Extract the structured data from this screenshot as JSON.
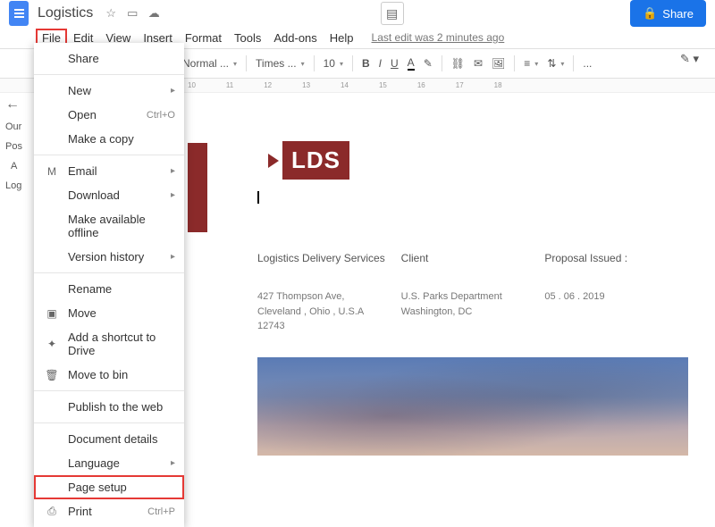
{
  "title": "Logistics",
  "shareLabel": "Share",
  "lastEdit": "Last edit was 2 minutes ago",
  "menus": {
    "file": "File",
    "edit": "Edit",
    "view": "View",
    "insert": "Insert",
    "format": "Format",
    "tools": "Tools",
    "addons": "Add-ons",
    "help": "Help"
  },
  "toolbar": {
    "style": "Normal ...",
    "font": "Times ...",
    "size": "10",
    "more": "..."
  },
  "ruler": [
    "10",
    "11",
    "12",
    "13",
    "14",
    "15",
    "16",
    "17",
    "18"
  ],
  "dropdown": {
    "share": "Share",
    "new": "New",
    "open": "Open",
    "openShort": "Ctrl+O",
    "makeCopy": "Make a copy",
    "email": "Email",
    "download": "Download",
    "offline": "Make available offline",
    "version": "Version history",
    "rename": "Rename",
    "move": "Move",
    "shortcut": "Add a shortcut to Drive",
    "trash": "Move to bin",
    "publish": "Publish to the web",
    "details": "Document details",
    "language": "Language",
    "pageSetup": "Page setup",
    "print": "Print",
    "printShort": "Ctrl+P"
  },
  "sidebar": {
    "our": "Our",
    "pos": "Pos",
    "a": "A",
    "log": "Log"
  },
  "doc": {
    "logo": "LDS",
    "h1": "Logistics Delivery Services",
    "h2": "Client",
    "h3": "Proposal Issued :",
    "addr": "427 Thompson Ave, Cleveland , Ohio , U.S.A 12743",
    "client": "U.S. Parks Department Washington, DC",
    "date": "05 . 06 . 2019"
  }
}
